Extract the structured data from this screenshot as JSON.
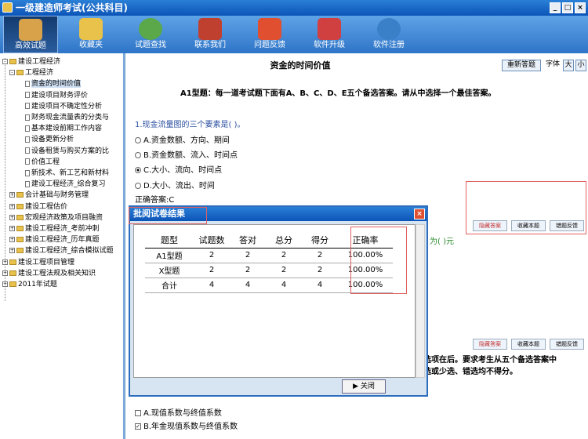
{
  "window": {
    "title": "一级建造师考试(公共科目)",
    "controls": [
      "_",
      "□",
      "×"
    ]
  },
  "toolbar": {
    "items": [
      {
        "label": "高效试题",
        "color": "#d8a24a"
      },
      {
        "label": "收藏夹",
        "color": "#e8c24a"
      },
      {
        "label": "试题查找",
        "color": "#5aa84a"
      },
      {
        "label": "联系我们",
        "color": "#c04030"
      },
      {
        "label": "问题反馈",
        "color": "#e05030"
      },
      {
        "label": "软件升级",
        "color": "#d04040"
      },
      {
        "label": "软件注册",
        "color": "#3a80c8"
      }
    ]
  },
  "tree": [
    {
      "label": "建设工程经济",
      "mark": "-",
      "level": 0
    },
    {
      "label": "工程经济",
      "mark": "-",
      "level": 1
    },
    {
      "label": "资金的时间价值",
      "level": 2,
      "selected": true
    },
    {
      "label": "建设项目财务评价",
      "level": 2
    },
    {
      "label": "建设项目不确定性分析",
      "level": 2
    },
    {
      "label": "财务现金流量表的分类与",
      "level": 2
    },
    {
      "label": "基本建设前期工作内容",
      "level": 2
    },
    {
      "label": "设备更新分析",
      "level": 2
    },
    {
      "label": "设备租赁与购买方案的比",
      "level": 2
    },
    {
      "label": "价值工程",
      "level": 2
    },
    {
      "label": "新技术、新工艺和新材料",
      "level": 2
    },
    {
      "label": "建设工程经济_综合复习",
      "level": 2
    },
    {
      "label": "会计基础与财务管理",
      "mark": "+",
      "level": 1
    },
    {
      "label": "建设工程估价",
      "mark": "+",
      "level": 1
    },
    {
      "label": "宏观经济政策及项目融资",
      "mark": "+",
      "level": 1
    },
    {
      "label": "建设工程经济_考前冲刺",
      "mark": "+",
      "level": 1
    },
    {
      "label": "建设工程经济_历年真题",
      "mark": "+",
      "level": 1
    },
    {
      "label": "建设工程经济_综合模拟试题",
      "mark": "+",
      "level": 1
    },
    {
      "label": "建设工程项目管理",
      "mark": "+",
      "level": 0
    },
    {
      "label": "建设工程法规及相关知识",
      "mark": "+",
      "level": 0
    },
    {
      "label": "2011年试题",
      "mark": "+",
      "level": 0
    }
  ],
  "content": {
    "section_title": "资金的时间价值",
    "controls": {
      "redo": "重新答题",
      "font": "字体",
      "big": "大",
      "small": "小"
    },
    "instruction": "A1型题：每一道考试题下面有A、B、C、D、E五个备选答案。请从中选择一个最佳答案。",
    "question1": "1.现金流量图的三个要素是( )。",
    "options1": [
      {
        "text": "A.资金数额、方向、期间",
        "checked": false
      },
      {
        "text": "B.资金数额、流入、时间点",
        "checked": false
      },
      {
        "text": "C.大小、流向、时间点",
        "checked": true
      },
      {
        "text": "D.大小、流出、时间",
        "checked": false
      }
    ],
    "answer": "正确答案:C",
    "partial_right": "为(   )元",
    "action_buttons": [
      "隐藏答案",
      "收藏本题",
      "错题反馈"
    ],
    "bottom_line1": "选项在后。要求考生从五个备选答案中",
    "bottom_line2": "选或少选、错选均不得分。",
    "options_x": [
      {
        "text": "A.现值系数与终值系数",
        "checked": false
      },
      {
        "text": "B.年金现值系数与终值系数",
        "checked": true
      }
    ]
  },
  "dialog": {
    "title": "批阅试卷结果",
    "headers": [
      "题型",
      "试题数",
      "答对",
      "总分",
      "得分",
      "正确率"
    ],
    "rows": [
      [
        "A1型题",
        "2",
        "2",
        "2",
        "2",
        "100.00%"
      ],
      [
        "X型题",
        "2",
        "2",
        "2",
        "2",
        "100.00%"
      ],
      [
        "合计",
        "4",
        "4",
        "4",
        "4",
        "100.00%"
      ]
    ],
    "close_label": "关闭"
  }
}
